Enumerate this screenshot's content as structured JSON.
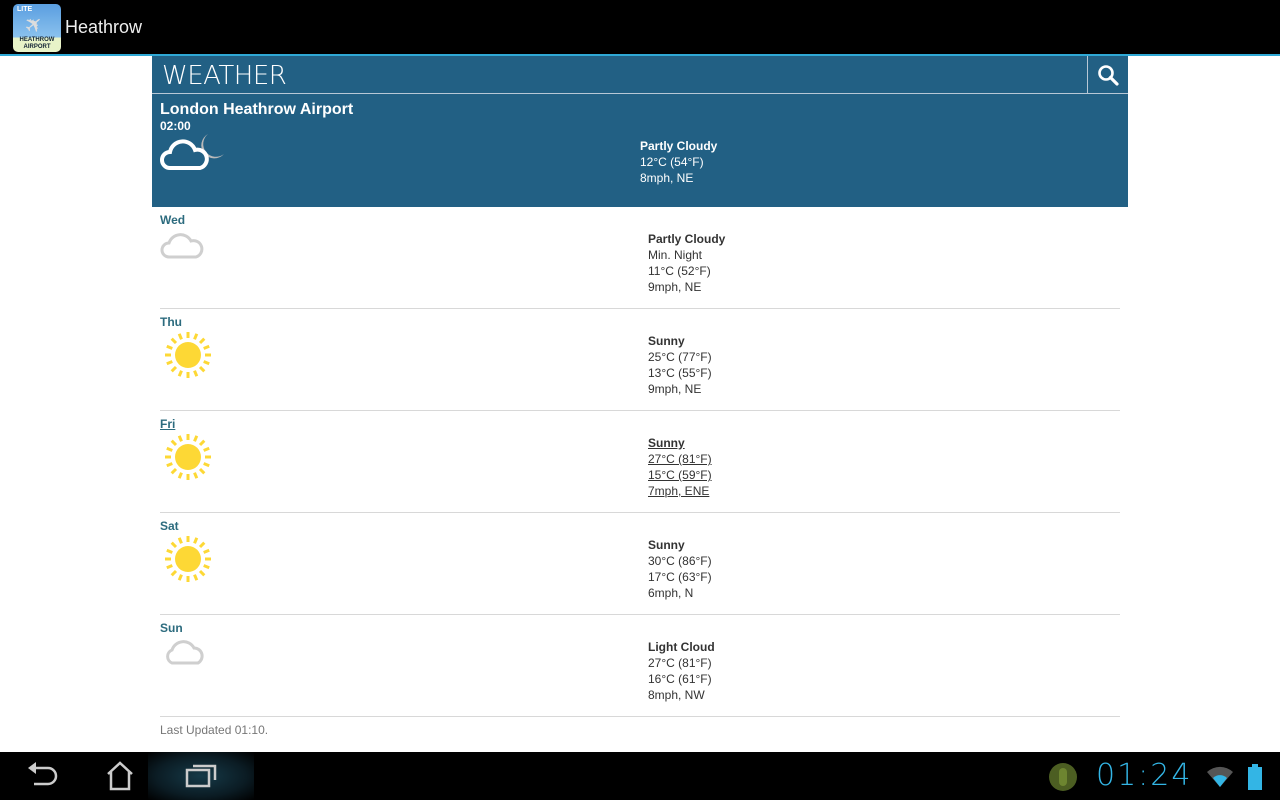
{
  "app": {
    "title": "Heathrow",
    "icon_text": [
      "LITE",
      "HEATHROW",
      "AIRPORT"
    ]
  },
  "header": {
    "title": "WEATHER",
    "search_icon": "search-icon"
  },
  "current": {
    "location": "London Heathrow Airport",
    "time": "02:00",
    "icon": "partly-cloudy-night",
    "condition": "Partly Cloudy",
    "temp": "12°C (54°F)",
    "wind": "8mph, NE"
  },
  "forecast": [
    {
      "day": "Wed",
      "icon": "partly-cloudy-night",
      "lines": [
        "Partly Cloudy",
        "Min. Night",
        "11°C (52°F)",
        "9mph, NE"
      ]
    },
    {
      "day": "Thu",
      "icon": "sunny",
      "lines": [
        "Sunny",
        "25°C (77°F)",
        "13°C (55°F)",
        "9mph, NE"
      ]
    },
    {
      "day": "Fri",
      "icon": "sunny",
      "lines": [
        "Sunny",
        "27°C (81°F)",
        "15°C (59°F)",
        "7mph, ENE"
      ],
      "focused": true
    },
    {
      "day": "Sat",
      "icon": "sunny",
      "lines": [
        "Sunny",
        "30°C (86°F)",
        "17°C (63°F)",
        "6mph, N"
      ]
    },
    {
      "day": "Sun",
      "icon": "light-cloud",
      "lines": [
        "Light Cloud",
        "27°C (81°F)",
        "16°C (61°F)",
        "8mph, NW"
      ]
    }
  ],
  "footer": {
    "last_updated": "Last Updated 01:10."
  },
  "status": {
    "clock": "01:24"
  },
  "colors": {
    "header": "#226084",
    "accent": "#33b5e5",
    "day_label": "#2c6b7e",
    "sun": "#fdd835"
  }
}
